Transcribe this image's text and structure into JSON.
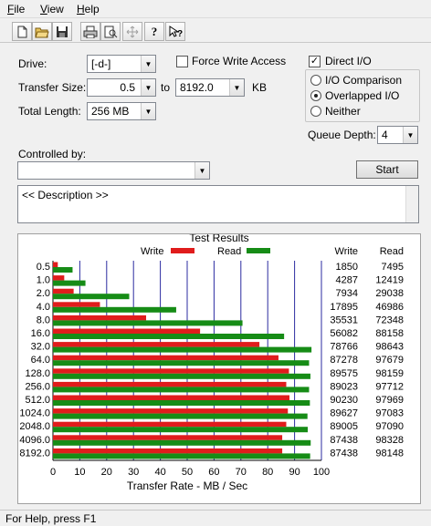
{
  "menu": [
    {
      "label": "File",
      "accel": "F"
    },
    {
      "label": "View",
      "accel": "V"
    },
    {
      "label": "Help",
      "accel": "H"
    }
  ],
  "toolbar": [
    "new-icon",
    "open-icon",
    "save-icon",
    "print-icon",
    "print-preview-icon",
    "move-icon",
    "help-icon",
    "context-help-icon"
  ],
  "drive": {
    "label": "Drive:",
    "value": "[-d-]"
  },
  "transfer": {
    "label": "Transfer Size:",
    "from": "0.5",
    "to_label": "to",
    "to": "8192.0",
    "unit": "KB"
  },
  "total_length": {
    "label": "Total Length:",
    "value": "256 MB"
  },
  "force_write": {
    "label": "Force Write Access",
    "checked": false
  },
  "direct_io": {
    "label": "Direct I/O",
    "checked": true
  },
  "io_modes": [
    {
      "label": "I/O Comparison",
      "selected": false
    },
    {
      "label": "Overlapped I/O",
      "selected": true
    },
    {
      "label": "Neither",
      "selected": false
    }
  ],
  "queue_depth": {
    "label": "Queue Depth:",
    "value": "4"
  },
  "controlled_by": {
    "label": "Controlled by:",
    "value": ""
  },
  "start_label": "Start",
  "description": "<< Description >>",
  "results": {
    "title": "Test Results",
    "write_label": "Write",
    "read_label": "Read"
  },
  "chart_data": {
    "type": "bar",
    "orientation": "horizontal",
    "title": "Test Results",
    "xlabel": "Transfer Rate - MB / Sec",
    "xlim": [
      0,
      100
    ],
    "xticks": [
      0,
      10,
      20,
      30,
      40,
      50,
      60,
      70,
      80,
      90,
      100
    ],
    "categories": [
      "0.5",
      "1.0",
      "2.0",
      "4.0",
      "8.0",
      "16.0",
      "32.0",
      "64.0",
      "128.0",
      "256.0",
      "512.0",
      "1024.0",
      "2048.0",
      "4096.0",
      "8192.0"
    ],
    "series": [
      {
        "name": "Write",
        "color": "#e01c1c",
        "values": [
          1.8,
          4.2,
          7.7,
          17.5,
          34.7,
          54.8,
          76.9,
          84.0,
          87.9,
          86.9,
          88.1,
          87.5,
          86.9,
          85.4,
          85.4
        ]
      },
      {
        "name": "Read",
        "color": "#168c16",
        "values": [
          7.3,
          12.1,
          28.4,
          45.9,
          70.6,
          86.1,
          96.3,
          95.4,
          95.9,
          95.4,
          95.7,
          94.8,
          94.9,
          96.0,
          95.8
        ]
      }
    ],
    "write_kbps": [
      "1850",
      "4287",
      "7934",
      "17895",
      "35531",
      "56082",
      "78766",
      "87278",
      "89575",
      "89023",
      "90230",
      "89627",
      "89005",
      "87438",
      "87438"
    ],
    "read_kbps": [
      "7495",
      "12419",
      "29038",
      "46986",
      "72348",
      "88158",
      "98643",
      "97679",
      "98159",
      "97712",
      "97969",
      "97083",
      "97090",
      "98328",
      "98148"
    ]
  },
  "status": "For Help, press F1"
}
